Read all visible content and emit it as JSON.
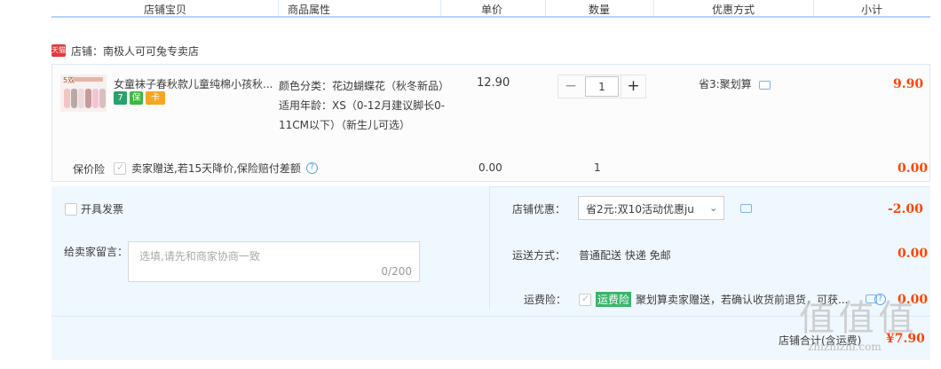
{
  "header": {
    "cols": [
      "店铺宝贝",
      "商品属性",
      "单价",
      "数量",
      "优惠方式",
      "小计"
    ]
  },
  "shop": {
    "badge": "天猫",
    "label": "店铺：南极人可可兔专卖店"
  },
  "item": {
    "thumb_text": "5双",
    "title": "女童袜子春秋款儿童纯棉小孩秋...",
    "badges": [
      "7",
      "保",
      "卡"
    ],
    "props_line1": "颜色分类：花边蝴蝶花（秋冬新品）",
    "props_line2": "适用年龄：XS（0-12月建议脚长0-11CM以下）（新生儿可选）",
    "price": "12.90",
    "qty": "1",
    "qty_minus": "−",
    "qty_plus": "+",
    "discount": "省3:聚划算",
    "subtotal": "9.90"
  },
  "insurance": {
    "label": "保价险",
    "text": "卖家赠送,若15天降价,保险赔付差额",
    "help": "?",
    "price": "0.00",
    "qty": "1",
    "subtotal": "0.00"
  },
  "invoice": {
    "label": "开具发票"
  },
  "memo": {
    "label": "给卖家留言：",
    "placeholder": "选填,请先和商家协商一致",
    "counter": "0/200"
  },
  "shop_discount": {
    "label": "店铺优惠：",
    "value": "省2元:双10活动优惠ju",
    "amount": "-2.00"
  },
  "shipping": {
    "label": "运送方式：",
    "value": "普通配送 快递 免邮",
    "amount": "0.00"
  },
  "return_insurance": {
    "label": "运费险：",
    "badge": "运费险",
    "text": "聚划算卖家赠送，若确认收货前退货，可获...",
    "amount": "0.00"
  },
  "total": {
    "label": "店铺合计(含运费)",
    "amount": "¥7.90"
  },
  "watermark": {
    "text": "值 值 值",
    "site": "zhizhizhi.com"
  },
  "colors": {
    "price_red": "#ff4400",
    "tmall_red": "#e4393c",
    "border_blue": "#b2d1ff",
    "panel_bg": "#f0f8ff",
    "green_badge": "#3bb46b"
  }
}
